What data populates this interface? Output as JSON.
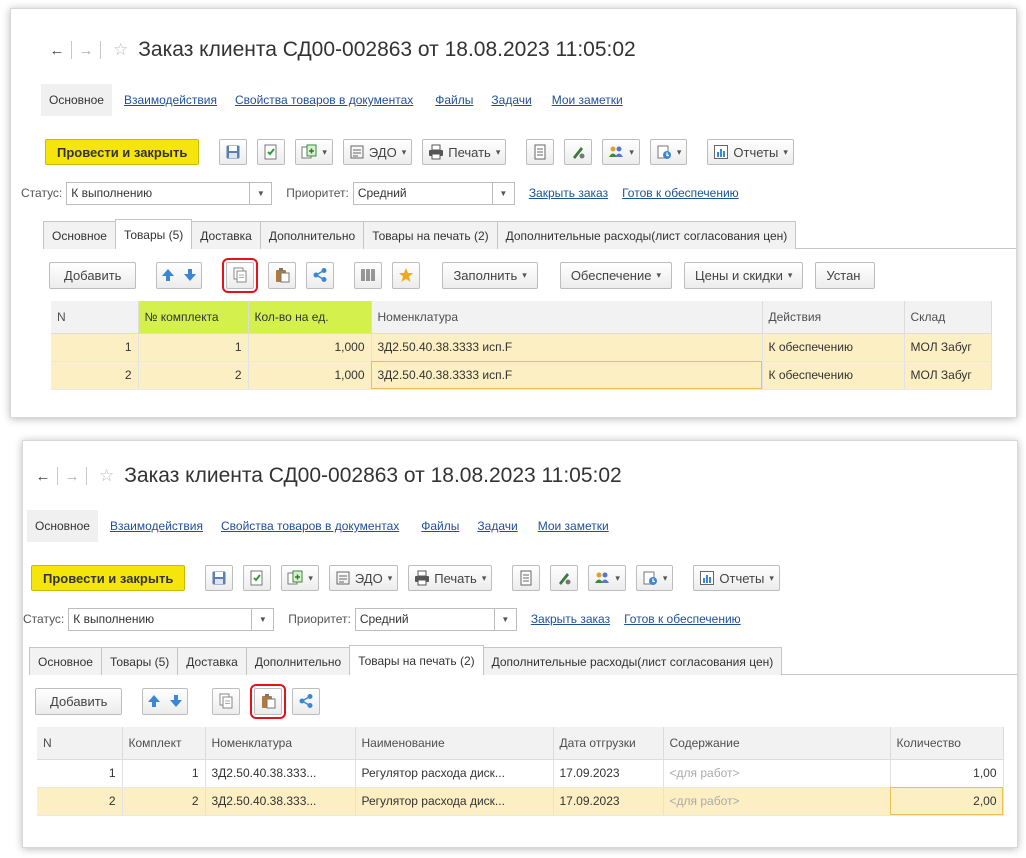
{
  "window": {
    "title": "Заказ клиента СД00-002863 от 18.08.2023 11:05:02"
  },
  "sections": [
    "Основное",
    "Взаимодействия",
    "Свойства товаров в документах",
    "Файлы",
    "Задачи",
    "Мои заметки"
  ],
  "toolbar": {
    "post_and_close": "Провести и закрыть",
    "edo": "ЭДО",
    "print": "Печать",
    "reports": "Отчеты"
  },
  "status": {
    "status_label": "Статус:",
    "status_value": "К выполнению",
    "priority_label": "Приоритет:",
    "priority_value": "Средний",
    "close_order_link": "Закрыть заказ",
    "ready_link": "Готов к обеспечению"
  },
  "tabs": [
    "Основное",
    "Товары (5)",
    "Доставка",
    "Дополнительно",
    "Товары на печать (2)",
    "Дополнительные расходы(лист согласования цен)"
  ],
  "goods_toolbar": {
    "add": "Добавить",
    "fill": "Заполнить",
    "supply": "Обеспечение",
    "prices": "Цены и скидки",
    "set": "Устан"
  },
  "print_toolbar": {
    "add": "Добавить"
  },
  "goods_table": {
    "columns": [
      "N",
      "№ комплекта",
      "Кол-во на ед.",
      "Номенклатура",
      "Действия",
      "Склад"
    ],
    "rows": [
      {
        "n": "1",
        "kit": "1",
        "qty": "1,000",
        "item": "3Д2.50.40.38.3333 исп.F",
        "action": "К обеспечению",
        "warehouse": "МОЛ Забуг"
      },
      {
        "n": "2",
        "kit": "2",
        "qty": "1,000",
        "item": "3Д2.50.40.38.3333 исп.F",
        "action": "К обеспечению",
        "warehouse": "МОЛ Забуг"
      }
    ]
  },
  "print_table": {
    "columns": [
      "N",
      "Комплект",
      "Номенклатура",
      "Наименование",
      "Дата отгрузки",
      "Содержание",
      "Количество"
    ],
    "rows": [
      {
        "n": "1",
        "kit": "1",
        "item": "3Д2.50.40.38.333...",
        "name": "Регулятор расхода диск...",
        "date": "17.09.2023",
        "content": "<для работ>",
        "qty": "1,00"
      },
      {
        "n": "2",
        "kit": "2",
        "item": "3Д2.50.40.38.333...",
        "name": "Регулятор расхода диск...",
        "date": "17.09.2023",
        "content": "<для работ>",
        "qty": "2,00"
      }
    ]
  },
  "colors": {
    "accent_yellow": "#f5e50a",
    "highlight_red": "#e3121b",
    "header_lime": "#d4f04d",
    "link_blue": "#1e4f9c",
    "selected_row": "#fbefc3"
  },
  "icons": [
    "back-arrow-icon",
    "forward-arrow-icon",
    "star-icon",
    "save-icon",
    "post-icon",
    "create-based-on-icon",
    "edo-icon",
    "print-icon",
    "list-icon",
    "signature-icon",
    "users-icon",
    "attachments-icon",
    "reports-icon",
    "move-up-icon",
    "move-down-icon",
    "copy-icon",
    "paste-icon",
    "share-icon",
    "barcode-icon",
    "favorite-star-icon"
  ]
}
